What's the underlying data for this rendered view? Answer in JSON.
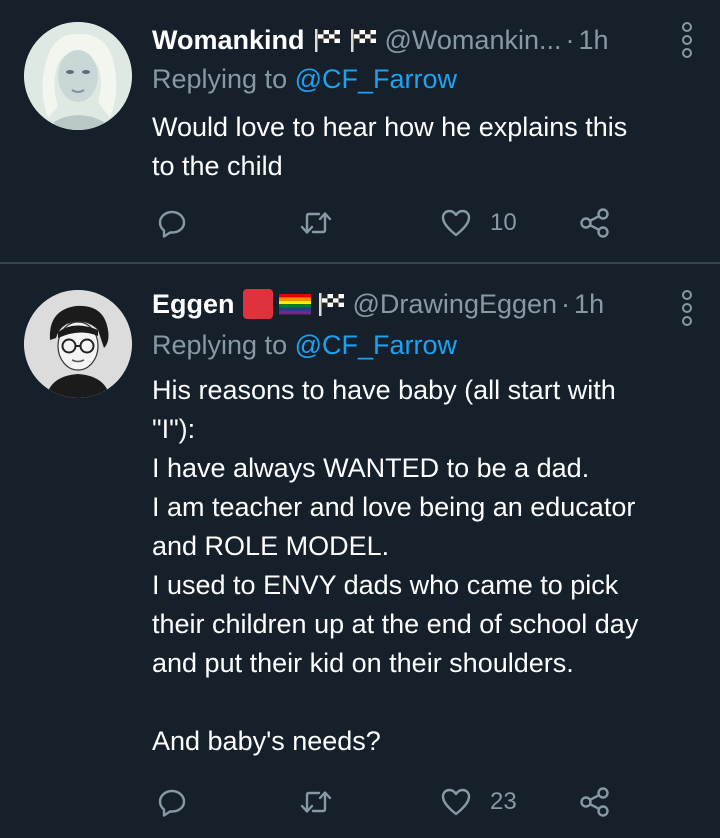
{
  "tweets": [
    {
      "display_name": "Womankind",
      "handle": "@Womankin...",
      "separator": "·",
      "time": "1h",
      "replying_prefix": "Replying to",
      "replying_to": "@CF_Farrow",
      "body_lines": [
        "Would love to hear how he explains this",
        "to the child"
      ],
      "like_count": "10",
      "retweet_count": "",
      "reply_count": ""
    },
    {
      "display_name": "Eggen",
      "handle": "@DrawingEggen",
      "separator": "·",
      "time": "1h",
      "replying_prefix": "Replying to",
      "replying_to": "@CF_Farrow",
      "body_lines": [
        "His reasons to have baby (all start with",
        "\"I\"):",
        "I have always WANTED to be a dad.",
        "I am teacher and love being an educator",
        "and ROLE MODEL.",
        "I used to ENVY dads who came to pick",
        "their children up at the end of school day",
        "and put their kid on their shoulders.",
        "",
        "And baby's needs?"
      ],
      "like_count": "23",
      "retweet_count": "",
      "reply_count": ""
    }
  ],
  "colors": {
    "background": "#15202b",
    "divider": "#38444d",
    "secondary_text": "#8899a6",
    "link": "#1da1f2",
    "primary_text": "#ffffff",
    "red_square_emoji": "#e0323c"
  },
  "icons": {
    "flag": "chequered-flag-icon",
    "reply": "reply-icon",
    "retweet": "retweet-icon",
    "like": "heart-icon",
    "share": "share-icon",
    "more": "more-options-icon"
  }
}
